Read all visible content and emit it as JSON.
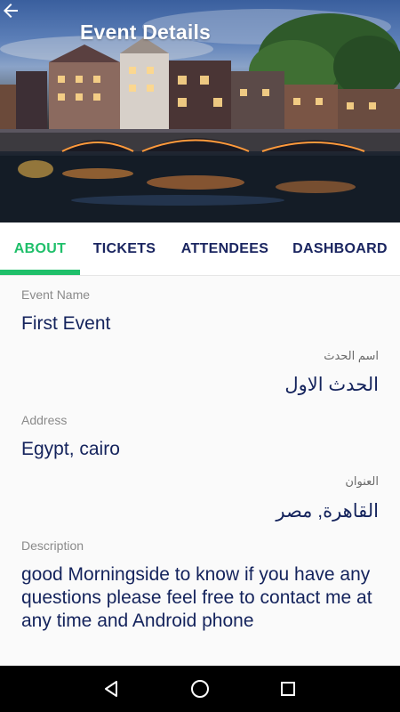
{
  "header": {
    "title": "Event Details",
    "back_icon": "arrow-left-icon"
  },
  "tabs": [
    {
      "label": "ABOUT",
      "active": true
    },
    {
      "label": "TICKETS",
      "active": false
    },
    {
      "label": "ATTENDEES",
      "active": false
    },
    {
      "label": "DASHBOARD",
      "active": false
    }
  ],
  "about": {
    "event_name_label": "Event Name",
    "event_name": "First Event",
    "event_name_ar_label": "اسم الحدث",
    "event_name_ar": "الحدث الاول",
    "address_label": "Address",
    "address": "Egypt, cairo",
    "address_ar_label": "العنوان",
    "address_ar": "القاهرة, مصر",
    "description_label": "Description",
    "description": "good Morningside to know if you have any questions please feel free to contact me at any time and Android phone"
  },
  "colors": {
    "accent": "#1fbf6a",
    "text_primary": "#14235c"
  },
  "navigation": {
    "back": "triangle-back-icon",
    "home": "circle-home-icon",
    "recents": "square-recents-icon"
  }
}
